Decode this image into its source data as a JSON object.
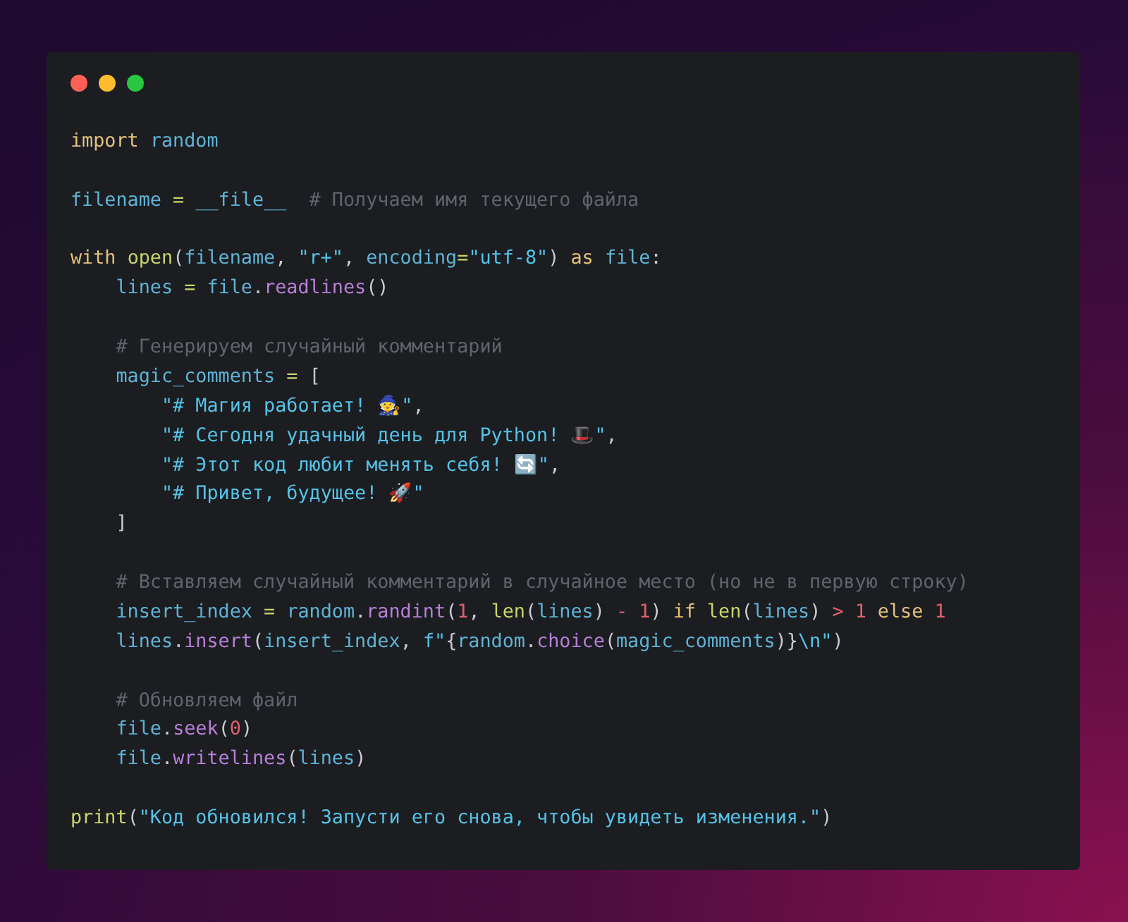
{
  "code_lines": [
    {
      "kind": "code",
      "tokens": [
        {
          "text": "import ",
          "kind": "keyword"
        },
        {
          "text": "random",
          "kind": "name"
        }
      ]
    },
    {
      "kind": "blank"
    },
    {
      "kind": "code",
      "tokens": [
        {
          "text": "filename",
          "kind": "name"
        },
        {
          "text": " = ",
          "kind": "assign"
        },
        {
          "text": "__file__",
          "kind": "name"
        },
        {
          "text": "  # Получаем имя текущего файла",
          "kind": "comment"
        }
      ]
    },
    {
      "kind": "blank"
    },
    {
      "kind": "code",
      "tokens": [
        {
          "text": "with ",
          "kind": "keyword"
        },
        {
          "text": "open",
          "kind": "builtin"
        },
        {
          "text": "(",
          "kind": "punc"
        },
        {
          "text": "filename",
          "kind": "name"
        },
        {
          "text": ", ",
          "kind": "punc"
        },
        {
          "text": "\"r+\"",
          "kind": "string"
        },
        {
          "text": ", ",
          "kind": "punc"
        },
        {
          "text": "encoding",
          "kind": "name"
        },
        {
          "text": "=",
          "kind": "assign"
        },
        {
          "text": "\"utf-8\"",
          "kind": "string"
        },
        {
          "text": ") ",
          "kind": "punc"
        },
        {
          "text": "as ",
          "kind": "keyword"
        },
        {
          "text": "file",
          "kind": "name"
        },
        {
          "text": ":",
          "kind": "punc"
        }
      ]
    },
    {
      "kind": "code",
      "tokens": [
        {
          "text": "    lines",
          "kind": "name"
        },
        {
          "text": " = ",
          "kind": "assign"
        },
        {
          "text": "file",
          "kind": "name"
        },
        {
          "text": ".",
          "kind": "punc"
        },
        {
          "text": "readlines",
          "kind": "method"
        },
        {
          "text": "()",
          "kind": "punc"
        }
      ]
    },
    {
      "kind": "blank"
    },
    {
      "kind": "code",
      "tokens": [
        {
          "text": "    # Генерируем случайный комментарий",
          "kind": "comment"
        }
      ]
    },
    {
      "kind": "code",
      "tokens": [
        {
          "text": "    magic_comments",
          "kind": "name"
        },
        {
          "text": " = ",
          "kind": "assign"
        },
        {
          "text": "[",
          "kind": "punc"
        }
      ]
    },
    {
      "kind": "code",
      "tokens": [
        {
          "text": "        \"# Магия работает! 🧙\"",
          "kind": "string"
        },
        {
          "text": ",",
          "kind": "punc"
        }
      ]
    },
    {
      "kind": "code",
      "tokens": [
        {
          "text": "        \"# Сегодня удачный день для Python! 🎩\"",
          "kind": "string"
        },
        {
          "text": ",",
          "kind": "punc"
        }
      ]
    },
    {
      "kind": "code",
      "tokens": [
        {
          "text": "        \"# Этот код любит менять себя! 🔄\"",
          "kind": "string"
        },
        {
          "text": ",",
          "kind": "punc"
        }
      ]
    },
    {
      "kind": "code",
      "tokens": [
        {
          "text": "        \"# Привет, будущее! 🚀\"",
          "kind": "string"
        }
      ]
    },
    {
      "kind": "code",
      "tokens": [
        {
          "text": "    ]",
          "kind": "punc"
        }
      ]
    },
    {
      "kind": "blank"
    },
    {
      "kind": "code",
      "tokens": [
        {
          "text": "    # Вставляем случайный комментарий в случайное место (но не в первую строку)",
          "kind": "comment"
        }
      ]
    },
    {
      "kind": "code",
      "tokens": [
        {
          "text": "    insert_index",
          "kind": "name"
        },
        {
          "text": " = ",
          "kind": "assign"
        },
        {
          "text": "random",
          "kind": "name"
        },
        {
          "text": ".",
          "kind": "punc"
        },
        {
          "text": "randint",
          "kind": "method"
        },
        {
          "text": "(",
          "kind": "punc"
        },
        {
          "text": "1",
          "kind": "number"
        },
        {
          "text": ", ",
          "kind": "punc"
        },
        {
          "text": "len",
          "kind": "builtin"
        },
        {
          "text": "(",
          "kind": "punc"
        },
        {
          "text": "lines",
          "kind": "name"
        },
        {
          "text": ") ",
          "kind": "punc"
        },
        {
          "text": "- ",
          "kind": "operator"
        },
        {
          "text": "1",
          "kind": "number"
        },
        {
          "text": ") ",
          "kind": "punc"
        },
        {
          "text": "if ",
          "kind": "keyword"
        },
        {
          "text": "len",
          "kind": "builtin"
        },
        {
          "text": "(",
          "kind": "punc"
        },
        {
          "text": "lines",
          "kind": "name"
        },
        {
          "text": ") ",
          "kind": "punc"
        },
        {
          "text": "> ",
          "kind": "operator"
        },
        {
          "text": "1",
          "kind": "number"
        },
        {
          "text": " else ",
          "kind": "keyword"
        },
        {
          "text": "1",
          "kind": "number"
        }
      ]
    },
    {
      "kind": "code",
      "tokens": [
        {
          "text": "    lines",
          "kind": "name"
        },
        {
          "text": ".",
          "kind": "punc"
        },
        {
          "text": "insert",
          "kind": "method"
        },
        {
          "text": "(",
          "kind": "punc"
        },
        {
          "text": "insert_index",
          "kind": "name"
        },
        {
          "text": ", ",
          "kind": "punc"
        },
        {
          "text": "f\"",
          "kind": "string"
        },
        {
          "text": "{",
          "kind": "punc"
        },
        {
          "text": "random",
          "kind": "name"
        },
        {
          "text": ".",
          "kind": "punc"
        },
        {
          "text": "choice",
          "kind": "method"
        },
        {
          "text": "(",
          "kind": "punc"
        },
        {
          "text": "magic_comments",
          "kind": "name"
        },
        {
          "text": ")}",
          "kind": "punc"
        },
        {
          "text": "\\n\"",
          "kind": "string"
        },
        {
          "text": ")",
          "kind": "punc"
        }
      ]
    },
    {
      "kind": "blank"
    },
    {
      "kind": "code",
      "tokens": [
        {
          "text": "    # Обновляем файл",
          "kind": "comment"
        }
      ]
    },
    {
      "kind": "code",
      "tokens": [
        {
          "text": "    file",
          "kind": "name"
        },
        {
          "text": ".",
          "kind": "punc"
        },
        {
          "text": "seek",
          "kind": "method"
        },
        {
          "text": "(",
          "kind": "punc"
        },
        {
          "text": "0",
          "kind": "number"
        },
        {
          "text": ")",
          "kind": "punc"
        }
      ]
    },
    {
      "kind": "code",
      "tokens": [
        {
          "text": "    file",
          "kind": "name"
        },
        {
          "text": ".",
          "kind": "punc"
        },
        {
          "text": "writelines",
          "kind": "method"
        },
        {
          "text": "(",
          "kind": "punc"
        },
        {
          "text": "lines",
          "kind": "name"
        },
        {
          "text": ")",
          "kind": "punc"
        }
      ]
    },
    {
      "kind": "blank"
    },
    {
      "kind": "code",
      "tokens": [
        {
          "text": "print",
          "kind": "builtin"
        },
        {
          "text": "(",
          "kind": "punc"
        },
        {
          "text": "\"Код обновился! Запусти его снова, чтобы увидеть изменения.\"",
          "kind": "string"
        },
        {
          "text": ")",
          "kind": "punc"
        }
      ]
    }
  ]
}
